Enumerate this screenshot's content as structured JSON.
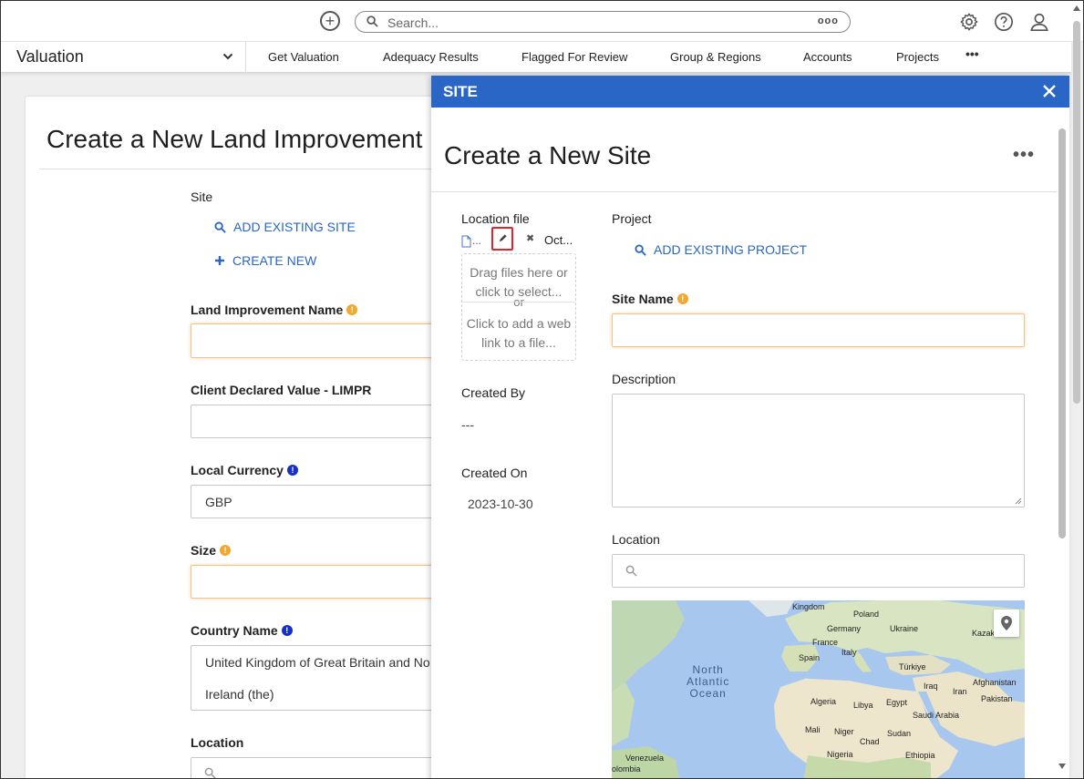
{
  "topbar": {
    "search_placeholder": "Search...",
    "search_more": "ooo"
  },
  "nav": {
    "app_title": "Valuation",
    "items": [
      "Get Valuation",
      "Adequacy Results",
      "Flagged For Review",
      "Group & Regions",
      "Accounts",
      "Projects"
    ],
    "more": "•••"
  },
  "background_form": {
    "title": "Create a New Land Improvement",
    "site_label": "Site",
    "add_existing_site": "ADD EXISTING SITE",
    "create_new": "CREATE NEW",
    "land_improvement_name_label": "Land Improvement Name",
    "client_declared_value_label": "Client Declared Value - LIMPR",
    "local_currency_label": "Local Currency",
    "local_currency_value": "GBP",
    "size_label": "Size",
    "country_name_label": "Country Name",
    "country_value_line1": "United Kingdom of Great Britain and No",
    "country_value_line2": "Ireland (the)",
    "location_label": "Location"
  },
  "panel": {
    "header": "SITE",
    "title": "Create a New Site",
    "location_file_label": "Location file",
    "file_name": "...",
    "file_name2": "Oct...",
    "drop_text_1": "Drag files here or",
    "drop_text_2": "click to select...",
    "drop_or": "or",
    "drop_text_3": "Click to add a web",
    "drop_text_4": "link to a file...",
    "created_by_label": "Created By",
    "created_by_value": "---",
    "created_on_label": "Created On",
    "created_on_value": "2023-10-30",
    "project_label": "Project",
    "add_existing_project": "ADD EXISTING PROJECT",
    "site_name_label": "Site Name",
    "description_label": "Description",
    "location_label": "Location",
    "map_labels": {
      "kingdom": "Kingdom",
      "poland": "Poland",
      "germany": "Germany",
      "ukraine": "Ukraine",
      "france": "France",
      "kazak": "Kazak",
      "italy": "Italy",
      "spain": "Spain",
      "turkiye": "Türkiye",
      "iraq": "Iraq",
      "afghanistan": "Afghanistan",
      "iran": "Iran",
      "ocean_1": "North",
      "ocean_2": "Atlantic",
      "ocean_3": "Ocean",
      "algeria": "Algeria",
      "libya": "Libya",
      "egypt": "Egypt",
      "pakistan": "Pakistan",
      "saudi": "Saudi Arabia",
      "mali": "Mali",
      "niger": "Niger",
      "chad": "Chad",
      "sudan": "Sudan",
      "nigeria": "Nigeria",
      "ethiopia": "Ethiopia",
      "venezuela": "Venezuela",
      "colombia": "olombia"
    }
  },
  "colors": {
    "accent": "#2a66c6",
    "link": "#2a66c2",
    "warning": "#f0a830",
    "info": "#1530c8",
    "highlight": "#e0242b"
  }
}
